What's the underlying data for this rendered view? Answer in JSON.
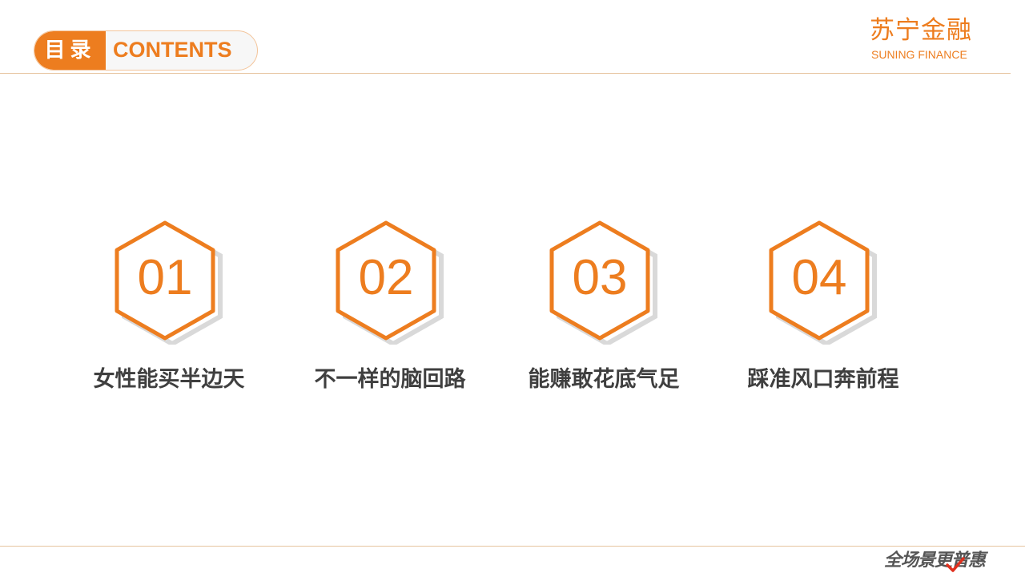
{
  "header": {
    "title_cn": "目录",
    "title_en": "CONTENTS"
  },
  "logo": {
    "name_cn": "苏宁金融",
    "name_en": "SUNING FINANCE"
  },
  "footer": {
    "slogan": "全场景更普惠"
  },
  "contents": [
    {
      "number": "01",
      "title": "女性能买半边天"
    },
    {
      "number": "02",
      "title": "不一样的脑回路"
    },
    {
      "number": "03",
      "title": "能赚敢花底气足"
    },
    {
      "number": "04",
      "title": "踩准风口奔前程"
    }
  ],
  "colors": {
    "accent": "#ed7d1f",
    "shadow": "#d9d9d9",
    "text": "#3f3f3f"
  }
}
